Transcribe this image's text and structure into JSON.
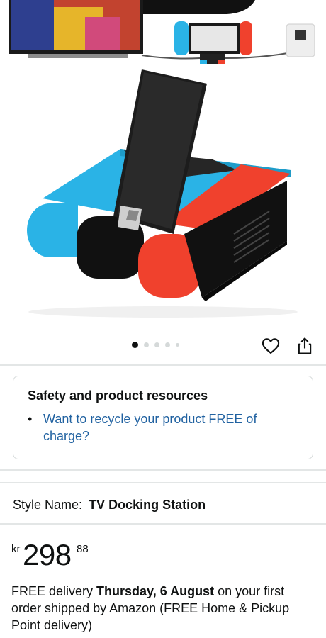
{
  "gallery": {
    "image_alt": "Switch TV docking station product image",
    "dots": [
      "active",
      "inactive",
      "inactive",
      "inactive",
      "inactive"
    ],
    "wishlist_icon": "heart-icon",
    "share_icon": "share-icon"
  },
  "safety": {
    "title": "Safety and product resources",
    "link_text": "Want to recycle your product FREE of charge?",
    "link_color": "#2162a1"
  },
  "style": {
    "label": "Style Name:",
    "value": "TV Docking Station"
  },
  "price": {
    "currency": "kr",
    "whole": "298",
    "fraction": "88"
  },
  "delivery": {
    "prefix": "FREE delivery ",
    "date": "Thursday, 6 August",
    "suffix": " on your first order shipped by Amazon (FREE Home & Pickup Point delivery)"
  },
  "colors": {
    "text": "#0f1111",
    "border": "#d5d9d9",
    "link": "#2162a1",
    "neon_blue": "#2ab3e6",
    "neon_red": "#f0412d"
  }
}
